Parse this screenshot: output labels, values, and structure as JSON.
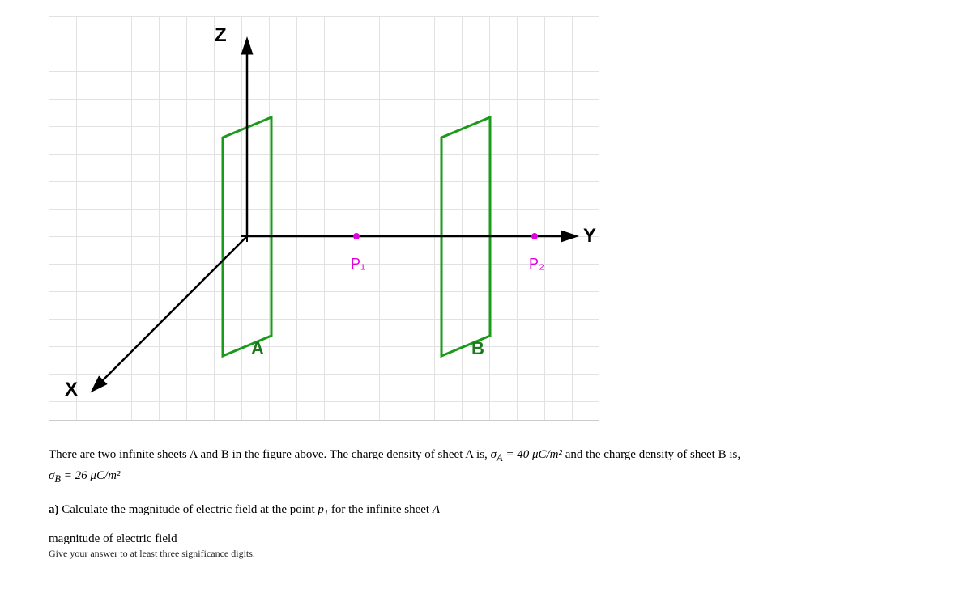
{
  "axes": {
    "z_label": "Z",
    "y_label": "Y",
    "x_label": "X"
  },
  "plates": {
    "a_label": "A",
    "b_label": "B"
  },
  "points": {
    "p1_label": "P₁",
    "p2_label": "P₂"
  },
  "question": {
    "intro_prefix": "There are two infinite sheets A and B in the figure above. The charge density of sheet A is, ",
    "sigma_a": "σ",
    "sigma_a_sub": "A",
    "sigma_a_eq": " = 40 μC/m²",
    "intro_mid": "and the charge density of sheet B is, ",
    "sigma_b": "σ",
    "sigma_b_sub": "B",
    "sigma_b_eq": " = 26 μC/m²",
    "part_a_label": "a)",
    "part_a_text": "Calculate the magnitude of electric field at the point ",
    "part_a_point": "p₁",
    "part_a_suffix": " for the infinite sheet ",
    "part_a_sheet": "A",
    "answer_label": "magnitude of electric field",
    "hint": "Give your answer to at least three significance digits."
  }
}
